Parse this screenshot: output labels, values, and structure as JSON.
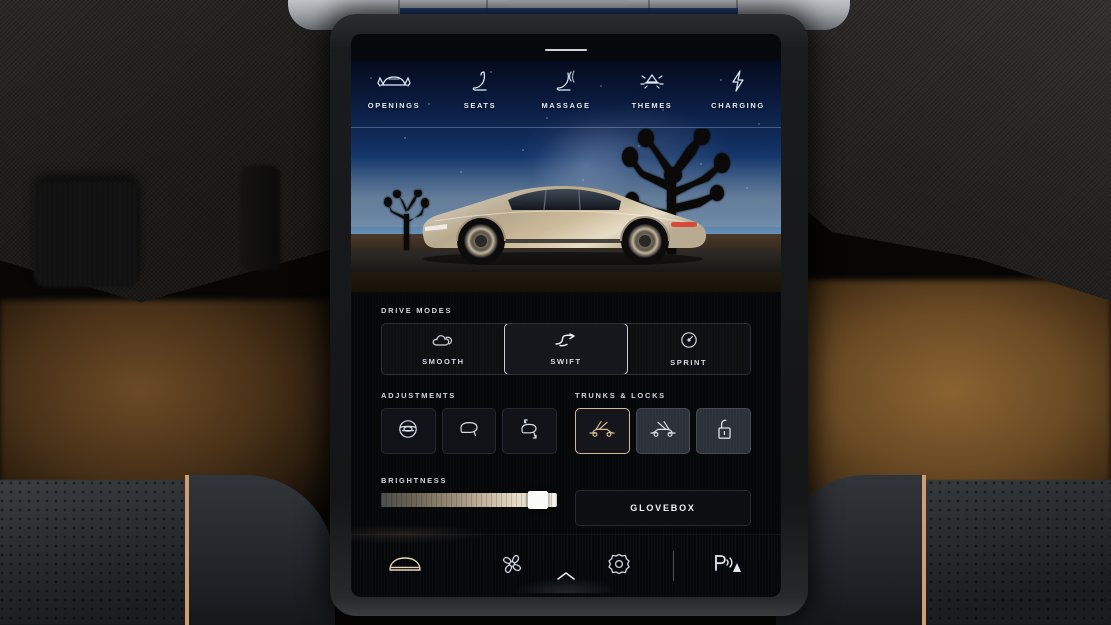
{
  "screen": {
    "top_tabs": [
      {
        "label": "OPENINGS",
        "icon": "car-doors-open-icon"
      },
      {
        "label": "SEATS",
        "icon": "seat-icon"
      },
      {
        "label": "MASSAGE",
        "icon": "massage-waves-icon"
      },
      {
        "label": "THEMES",
        "icon": "lamp-light-icon"
      },
      {
        "label": "CHARGING",
        "icon": "lightning-bolt-icon"
      }
    ],
    "hero": {
      "vehicle": "lucid-air-sedan",
      "scene": "desert-dusk-joshua-trees"
    },
    "drive_modes": {
      "label": "DRIVE MODES",
      "selected": "SWIFT",
      "options": [
        {
          "label": "SMOOTH",
          "icon": "cloud-icon",
          "active": false
        },
        {
          "label": "SWIFT",
          "icon": "winding-road-icon",
          "active": true
        },
        {
          "label": "SPRINT",
          "icon": "gauge-icon",
          "active": false
        }
      ]
    },
    "adjustments": {
      "label": "ADJUSTMENTS",
      "buttons": [
        {
          "icon": "steering-wheel-icon",
          "state": "default"
        },
        {
          "icon": "side-mirror-icon",
          "state": "default"
        },
        {
          "icon": "mirror-fold-icon",
          "state": "default"
        }
      ]
    },
    "trunks_locks": {
      "label": "TRUNKS & LOCKS",
      "buttons": [
        {
          "icon": "frunk-open-icon",
          "state": "active"
        },
        {
          "icon": "trunk-open-icon",
          "state": "slate"
        },
        {
          "icon": "unlock-padlock-icon",
          "state": "slate"
        }
      ]
    },
    "brightness": {
      "label": "BRIGHTNESS",
      "value": 89
    },
    "glovebox": {
      "label": "GLOVEBOX"
    },
    "dock": [
      {
        "icon": "car-front-icon",
        "active": true
      },
      {
        "icon": "fan-icon",
        "active": false
      },
      {
        "icon": "gear-icon",
        "active": false
      },
      {
        "icon": "parking-sensor-icon",
        "active": false
      }
    ],
    "dock_handle_icon": "chevron-up-icon",
    "pull_handle_icon": "drag-handle-bar"
  },
  "colors": {
    "accent_gold": "#d7b894",
    "text_primary": "#eef1f6",
    "text_dim": "#cfd6e2",
    "panel_bg": "#060709",
    "slate_btn": "#2c3139",
    "sky_deep": "#040a1c",
    "sky_blue": "#2a5c96"
  }
}
